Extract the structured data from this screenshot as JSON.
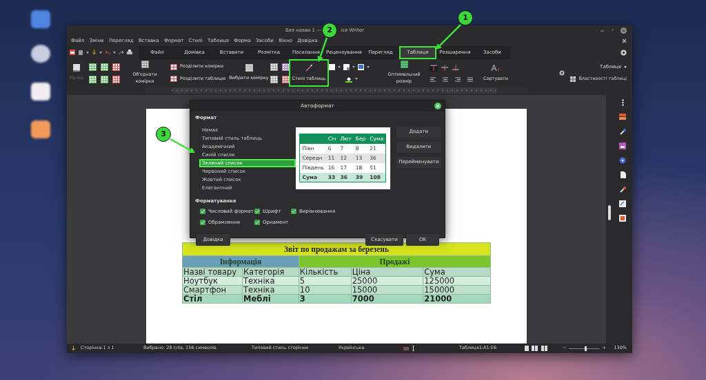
{
  "window": {
    "title_parts": [
      "Без назви 1 —",
      "ice Writer"
    ]
  },
  "menu": [
    "Файл",
    "Зміни",
    "Перегляд",
    "Вставка",
    "Формат",
    "Стилі",
    "Таблиця",
    "Форма",
    "Засоби",
    "Вікно",
    "Довідка"
  ],
  "tabs": [
    {
      "label": "Файл",
      "selected": false,
      "highlighted": false
    },
    {
      "label": "Домівка",
      "selected": false,
      "highlighted": false
    },
    {
      "label": "Вставити",
      "selected": false,
      "highlighted": false
    },
    {
      "label": "Розмітка",
      "selected": false,
      "highlighted": false
    },
    {
      "label": "Посилання",
      "selected": false,
      "highlighted": false
    },
    {
      "label": "Рецензування",
      "selected": false,
      "highlighted": false
    },
    {
      "label": "Перегляд",
      "selected": false,
      "highlighted": false
    },
    {
      "label": "Таблиця",
      "selected": true,
      "highlighted": true
    },
    {
      "label": "Розширення",
      "selected": false,
      "highlighted": false
    },
    {
      "label": "Засоби",
      "selected": false,
      "highlighted": false
    }
  ],
  "ribbon": {
    "items": [
      {
        "kind": "style",
        "label": "Назва",
        "disabled": true
      },
      {
        "kind": "grid"
      },
      {
        "kind": "large",
        "label": "Об'єднати комірки",
        "highlighted": false
      },
      {
        "kind": "pair",
        "labels": [
          "Розділити комірки",
          "Розділити таблицю"
        ]
      },
      {
        "kind": "large",
        "label": "Вибрати комірку",
        "highlighted": false
      },
      {
        "kind": "grid"
      },
      {
        "kind": "large",
        "label": "Стилі таблиць",
        "highlighted": true
      },
      {
        "kind": "colors"
      },
      {
        "kind": "large",
        "label": "Оптимальний розмір",
        "highlighted": false
      },
      {
        "kind": "align",
        "valign": [
          {
            "selected": true
          },
          {
            "selected": false
          },
          {
            "selected": false
          }
        ]
      },
      {
        "kind": "large",
        "label": "Сортувати",
        "highlighted": false
      }
    ],
    "panel_title": "Таблиця",
    "properties": "Властивості таблиці"
  },
  "document": {
    "table": {
      "title": "Звіт по продажам за березень",
      "groups": [
        {
          "label": "Інформація",
          "color": "#6a9fb5"
        },
        {
          "label": "Продажі",
          "color": "#7cc62c"
        }
      ],
      "rows": [
        {
          "kind": "header",
          "cells": [
            "Назві товару",
            "Категорія",
            "Кількість",
            "Ціна",
            "Сума"
          ]
        },
        {
          "kind": "odd",
          "cells": [
            "Ноутбук",
            "Техніка",
            "5",
            "25000",
            "125000"
          ]
        },
        {
          "kind": "even",
          "cells": [
            "Смартфон",
            "Техніка",
            "10",
            "15000",
            "150000"
          ]
        },
        {
          "kind": "total",
          "cells": [
            "Стіл",
            "Меблі",
            "3",
            "7000",
            "21000"
          ]
        }
      ]
    }
  },
  "dialog": {
    "title": "Автоформат",
    "format_label": "Формат",
    "styles": [
      {
        "label": "Немає",
        "selected": false
      },
      {
        "label": "Типовий стиль таблиць",
        "selected": false
      },
      {
        "label": "Академічний",
        "selected": false
      },
      {
        "label": "Синій список",
        "selected": false
      },
      {
        "label": "Зелений список",
        "selected": true
      },
      {
        "label": "Червоний список",
        "selected": false
      },
      {
        "label": "Жовтий список",
        "selected": false
      },
      {
        "label": "Елегантний",
        "selected": false
      }
    ],
    "preview": {
      "columns": [
        "Січ",
        "Лют",
        "Бер",
        "Сума"
      ],
      "rows": [
        {
          "kind": "odd",
          "label": "Півн",
          "values": [
            "6",
            "7",
            "8",
            "21"
          ]
        },
        {
          "kind": "even",
          "label": "Середн",
          "values": [
            "11",
            "12",
            "13",
            "36"
          ]
        },
        {
          "kind": "odd",
          "label": "Південь",
          "values": [
            "16",
            "17",
            "18",
            "51"
          ]
        },
        {
          "kind": "total",
          "label": "Сума",
          "values": [
            "33",
            "36",
            "39",
            "108"
          ]
        }
      ]
    },
    "side_buttons": [
      "Додати",
      "Видалити",
      "Перейменувати"
    ],
    "formatting_label": "Форматування",
    "options": [
      {
        "label": "Числовий формат",
        "checked": true
      },
      {
        "label": "Шрифт",
        "checked": true
      },
      {
        "label": "Вирівнювання",
        "checked": true
      },
      {
        "label": "Обрамлення",
        "checked": true
      },
      {
        "label": "Орнамент",
        "checked": true
      }
    ],
    "help": "Довідка",
    "cancel": "Скасувати",
    "ok": "OK"
  },
  "status_bar": {
    "page": "Сторінка 1 з 1",
    "selection": "Вибрано: 28 слів, 156 символів",
    "page_style": "Типовий стиль сторінки",
    "language": "Українська",
    "cell_range": "Таблиця1:A1:E6",
    "zoom": {
      "minus": "−",
      "level": 0.55,
      "plus": "+",
      "reading": "130%"
    }
  },
  "callouts": [
    {
      "number": "1"
    },
    {
      "number": "2"
    },
    {
      "number": "3"
    }
  ]
}
